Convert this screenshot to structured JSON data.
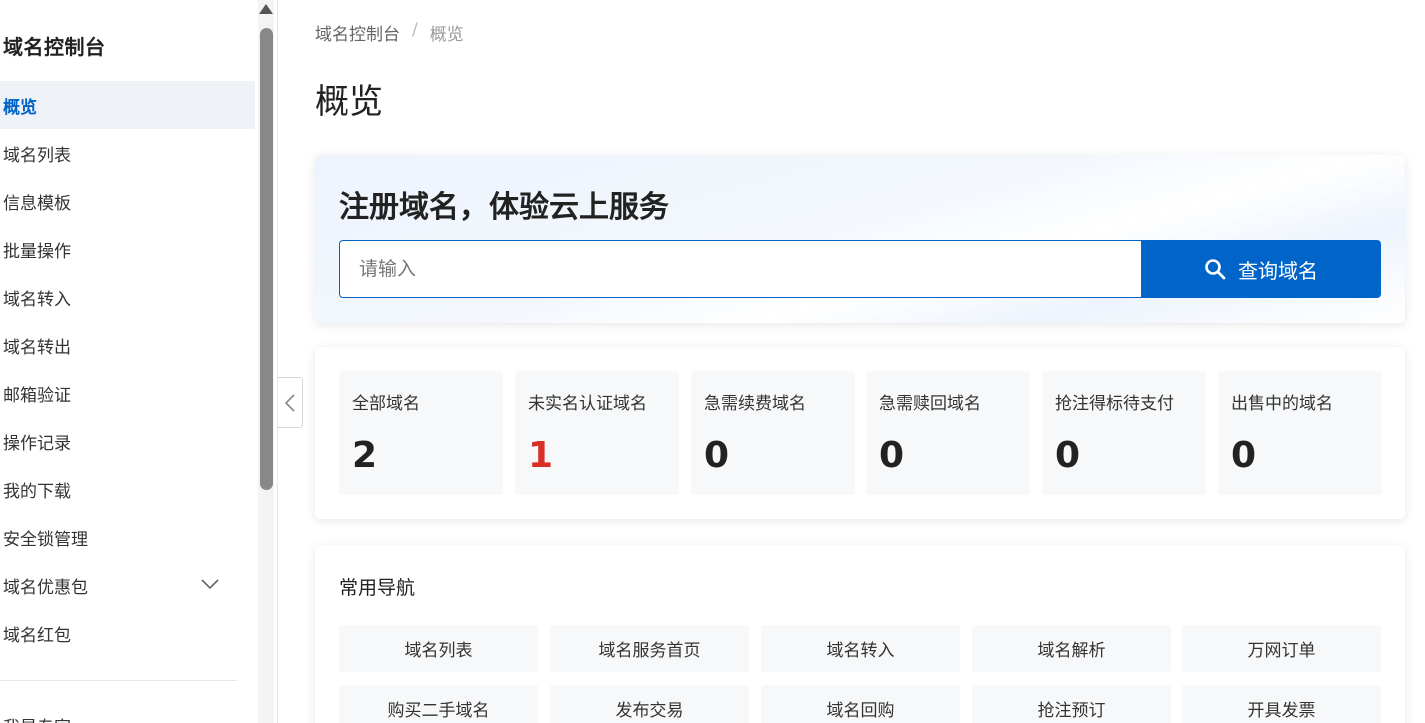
{
  "sidebar": {
    "title": "域名控制台",
    "items": [
      {
        "label": "概览"
      },
      {
        "label": "域名列表"
      },
      {
        "label": "信息模板"
      },
      {
        "label": "批量操作"
      },
      {
        "label": "域名转入"
      },
      {
        "label": "域名转出"
      },
      {
        "label": "邮箱验证"
      },
      {
        "label": "操作记录"
      },
      {
        "label": "我的下载"
      },
      {
        "label": "安全锁管理"
      },
      {
        "label": "域名优惠包"
      },
      {
        "label": "域名红包"
      }
    ],
    "cut_item": "我是专家"
  },
  "breadcrumb": {
    "home": "域名控制台",
    "sep": "/",
    "current": "概览"
  },
  "page": {
    "title": "概览"
  },
  "hero": {
    "title": "注册域名，体验云上服务",
    "search_placeholder": "请输入",
    "search_button": "查询域名"
  },
  "stats": [
    {
      "label": "全部域名",
      "value": "2"
    },
    {
      "label": "未实名认证域名",
      "value": "1"
    },
    {
      "label": "急需续费域名",
      "value": "0"
    },
    {
      "label": "急需赎回域名",
      "value": "0"
    },
    {
      "label": "抢注得标待支付",
      "value": "0"
    },
    {
      "label": "出售中的域名",
      "value": "0"
    }
  ],
  "quick_nav": {
    "title": "常用导航",
    "items": [
      {
        "label": "域名列表"
      },
      {
        "label": "域名服务首页"
      },
      {
        "label": "域名转入"
      },
      {
        "label": "域名解析"
      },
      {
        "label": "万网订单"
      },
      {
        "label": "购买二手域名"
      },
      {
        "label": "发布交易"
      },
      {
        "label": "域名回购"
      },
      {
        "label": "抢注预订"
      },
      {
        "label": "开具发票"
      }
    ]
  },
  "colors": {
    "brand": "#0064c8",
    "alert": "#d93026",
    "card_bg": "#f7f8fa",
    "active_bg": "#eef1f6"
  }
}
